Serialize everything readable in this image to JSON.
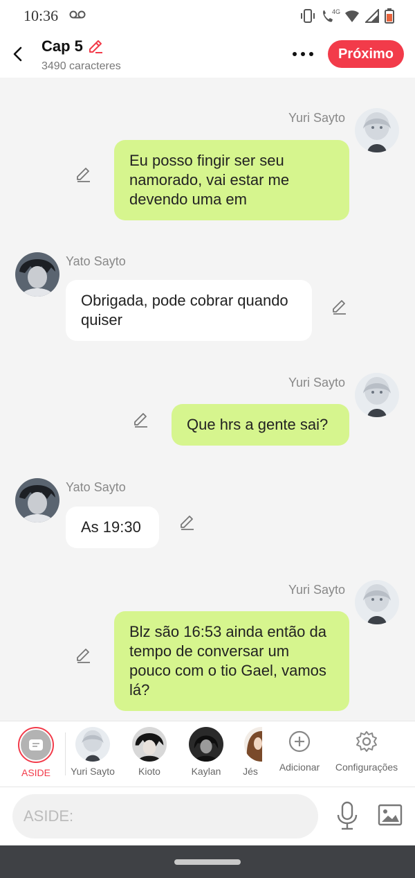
{
  "status": {
    "time": "10:36",
    "network": "4G"
  },
  "header": {
    "title": "Cap 5",
    "chars": "3490 caracteres",
    "next_label": "Próximo"
  },
  "messages": [
    {
      "name": "Yuri Sayto",
      "side": "right",
      "text": "Eu posso fingir ser seu namorado, vai estar me devendo uma em"
    },
    {
      "name": "Yato Sayto",
      "side": "left",
      "text": "Obrigada, pode cobrar quando quiser"
    },
    {
      "name": "Yuri Sayto",
      "side": "right",
      "text": "Que hrs a gente sai?"
    },
    {
      "name": "Yato Sayto",
      "side": "left",
      "text": "As 19:30"
    },
    {
      "name": "Yuri Sayto",
      "side": "right",
      "text": "Blz são 16:53 ainda então da tempo de conversar um pouco com o tio Gael, vamos lá?"
    }
  ],
  "characters": [
    {
      "label": "ASIDE"
    },
    {
      "label": "Yuri Sayto"
    },
    {
      "label": "Kioto"
    },
    {
      "label": "Kaylan"
    },
    {
      "label": "Jés"
    },
    {
      "label": "Adicionar"
    },
    {
      "label": "Configurações"
    }
  ],
  "input": {
    "placeholder": "ASIDE:"
  },
  "colors": {
    "accent": "#f23b4a",
    "bubble_right": "#d6f58e",
    "bubble_left": "#ffffff"
  }
}
